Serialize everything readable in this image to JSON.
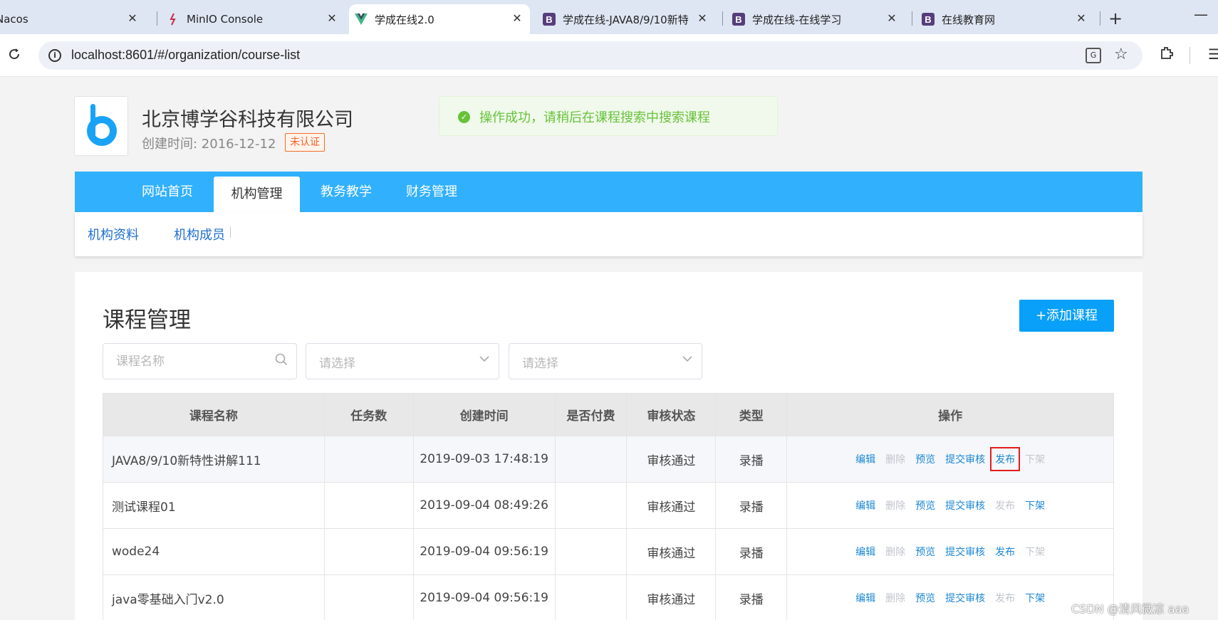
{
  "browser": {
    "tabs": [
      {
        "title": "Nacos",
        "favicon": "none"
      },
      {
        "title": "MinIO Console",
        "favicon": "minio-icon"
      },
      {
        "title": "学成在线2.0",
        "favicon": "vue-icon",
        "active": true
      },
      {
        "title": "学成在线-JAVA8/9/10新特",
        "favicon": "bootstrap-icon"
      },
      {
        "title": "学成在线-在线学习",
        "favicon": "bootstrap-icon"
      },
      {
        "title": "在线教育网",
        "favicon": "bootstrap-icon"
      }
    ],
    "close_glyph": "✕",
    "new_tab_glyph": "+",
    "minimize_glyph": "—",
    "url": "localhost:8601/#/organization/course-list",
    "favicon_b": "B"
  },
  "org": {
    "name": "北京博学谷科技有限公司",
    "created_label": "创建时间: 2016-12-12",
    "badge": "未认证"
  },
  "toast": {
    "message": "操作成功，请稍后在课程搜索中搜索课程"
  },
  "nav": {
    "items": [
      "网站首页",
      "机构管理",
      "教务教学",
      "财务管理"
    ],
    "active_index": 1
  },
  "subnav": {
    "items": [
      "机构资料",
      "机构成员"
    ]
  },
  "panel": {
    "title": "课程管理",
    "add_button": "+添加课程",
    "search_placeholder": "课程名称",
    "select1_placeholder": "请选择",
    "select2_placeholder": "请选择"
  },
  "table": {
    "headers": [
      "课程名称",
      "任务数",
      "创建时间",
      "是否付费",
      "审核状态",
      "类型",
      "操作"
    ],
    "rows": [
      {
        "name": "JAVA8/9/10新特性讲解111",
        "tasks": "",
        "created": "2019-09-03 17:48:19",
        "paid": "",
        "status": "审核通过",
        "type": "录播",
        "ops": [
          {
            "label": "编辑",
            "enabled": true
          },
          {
            "label": "删除",
            "enabled": false
          },
          {
            "label": "预览",
            "enabled": true
          },
          {
            "label": "提交审核",
            "enabled": true
          },
          {
            "label": "发布",
            "enabled": true,
            "highlighted": true
          },
          {
            "label": "下架",
            "enabled": false
          }
        ]
      },
      {
        "name": "测试课程01",
        "tasks": "",
        "created": "2019-09-04 08:49:26",
        "paid": "",
        "status": "审核通过",
        "type": "录播",
        "ops": [
          {
            "label": "编辑",
            "enabled": true
          },
          {
            "label": "删除",
            "enabled": false
          },
          {
            "label": "预览",
            "enabled": true
          },
          {
            "label": "提交审核",
            "enabled": true
          },
          {
            "label": "发布",
            "enabled": false
          },
          {
            "label": "下架",
            "enabled": true
          }
        ]
      },
      {
        "name": "wode24",
        "tasks": "",
        "created": "2019-09-04 09:56:19",
        "paid": "",
        "status": "审核通过",
        "type": "录播",
        "ops": [
          {
            "label": "编辑",
            "enabled": true
          },
          {
            "label": "删除",
            "enabled": false
          },
          {
            "label": "预览",
            "enabled": true
          },
          {
            "label": "提交审核",
            "enabled": true
          },
          {
            "label": "发布",
            "enabled": true
          },
          {
            "label": "下架",
            "enabled": false
          }
        ]
      },
      {
        "name": "java零基础入门v2.0",
        "tasks": "",
        "created": "2019-09-04 09:56:19",
        "paid": "",
        "status": "审核通过",
        "type": "录播",
        "ops": [
          {
            "label": "编辑",
            "enabled": true
          },
          {
            "label": "删除",
            "enabled": false
          },
          {
            "label": "预览",
            "enabled": true
          },
          {
            "label": "提交审核",
            "enabled": true
          },
          {
            "label": "发布",
            "enabled": false
          },
          {
            "label": "下架",
            "enabled": true
          }
        ]
      }
    ]
  },
  "watermark": "CSDN @清风微凉 aaa",
  "colors": {
    "nav_bg": "#31b0fd",
    "primary_button": "#08a0f8",
    "link": "#1b87d3",
    "disabled": "#c0c4cc",
    "success": "#67c23a",
    "badge": "#f5622a",
    "highlight_box": "#e51b1b"
  }
}
